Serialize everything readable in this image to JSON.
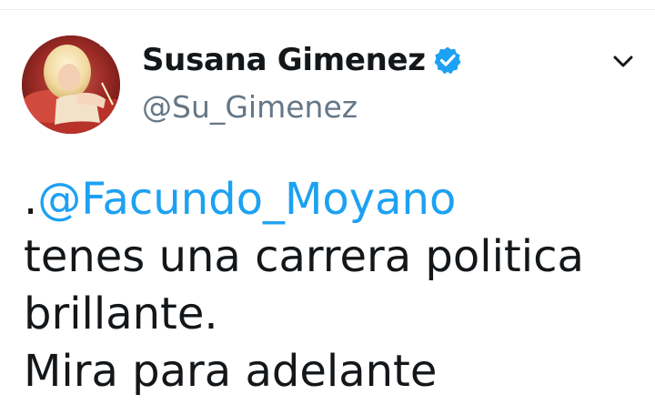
{
  "tweet": {
    "author": {
      "display_name": "Susana Gimenez",
      "username": "@Su_Gimenez",
      "verified": true,
      "avatar_icon": "profile-photo"
    },
    "menu_icon": "chevron-down-icon",
    "body": {
      "line1_prefix": ".",
      "line1_mention": "@Facundo_Moyano",
      "line2": "tenes una carrera politica",
      "line3": "brillante.",
      "line4": "Mira para adelante"
    }
  },
  "colors": {
    "mention": "#1da1f2",
    "verified": "#1da1f2",
    "username": "#657786",
    "text": "#14171a"
  }
}
